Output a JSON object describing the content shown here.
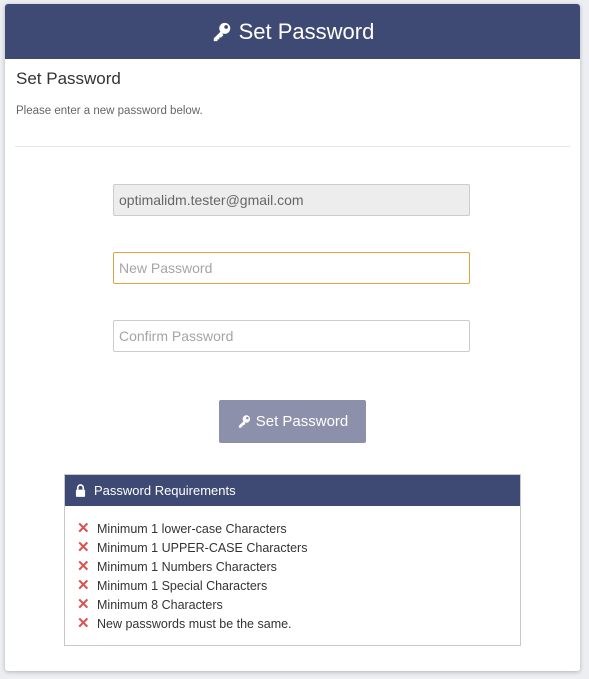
{
  "header": {
    "title": "Set Password",
    "icon": "key-icon"
  },
  "form": {
    "subtitle": "Set Password",
    "instruction": "Please enter a new password below.",
    "email_value": "optimalidm.tester@gmail.com",
    "new_password_placeholder": "New Password",
    "confirm_password_placeholder": "Confirm Password",
    "submit_label": "Set Password"
  },
  "requirements": {
    "title": "Password Requirements",
    "items": [
      {
        "label": "Minimum 1 lower-case Characters",
        "met": false
      },
      {
        "label": "Minimum 1 UPPER-CASE Characters",
        "met": false
      },
      {
        "label": "Minimum 1 Numbers Characters",
        "met": false
      },
      {
        "label": "Minimum 1 Special Characters",
        "met": false
      },
      {
        "label": "Minimum 8 Characters",
        "met": false
      },
      {
        "label": "New passwords must be the same.",
        "met": false
      }
    ]
  },
  "colors": {
    "header_bg": "#3f4a74",
    "button_bg": "#8c90aa",
    "error_icon": "#d9534f",
    "focus_border": "#d9a441"
  }
}
